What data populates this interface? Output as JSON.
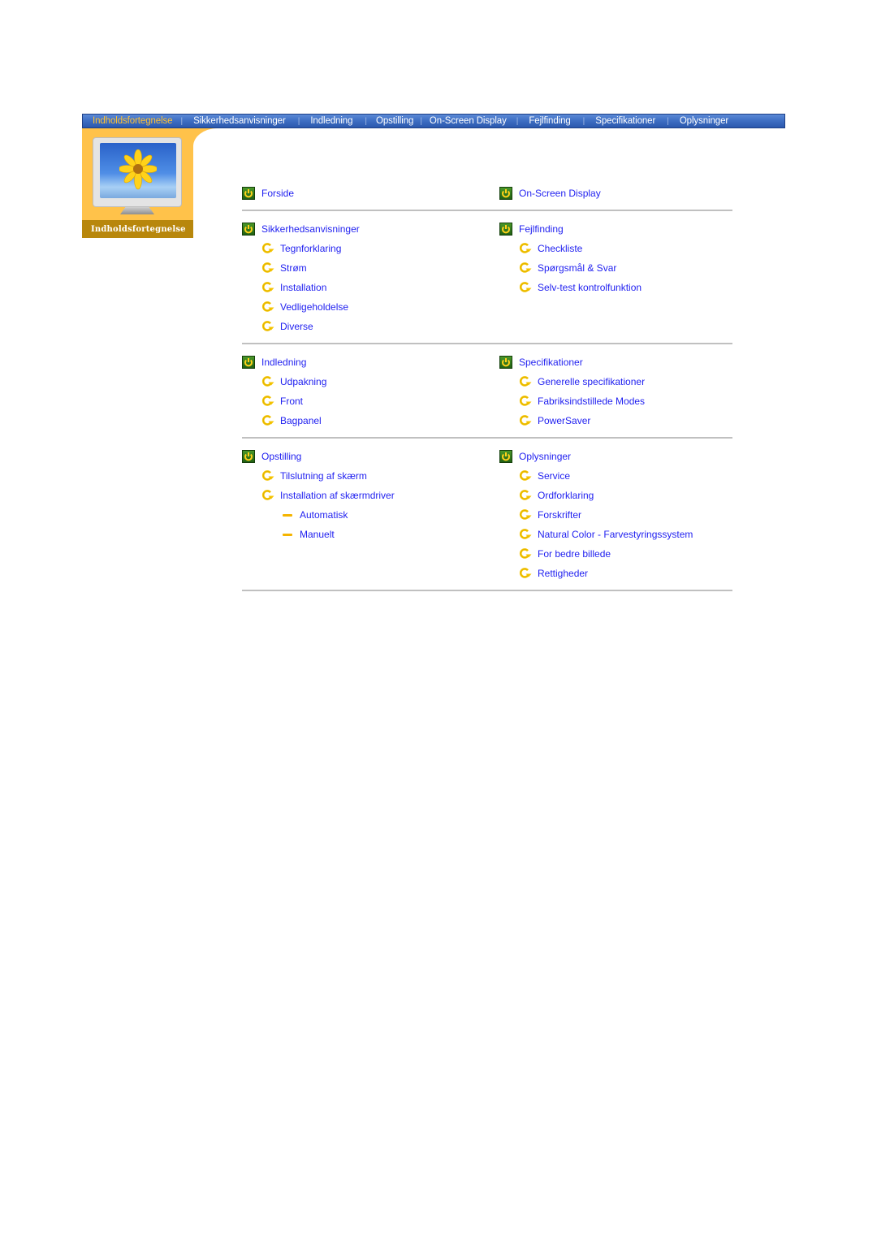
{
  "nav": {
    "items": [
      {
        "label": "Indholdsfortegnelse",
        "active": true
      },
      {
        "label": "Sikkerhedsanvisninger",
        "active": false
      },
      {
        "label": "Indledning",
        "active": false
      },
      {
        "label": "Opstilling",
        "active": false
      },
      {
        "label": "On-Screen Display",
        "active": false
      },
      {
        "label": "Fejlfinding",
        "active": false
      },
      {
        "label": "Specifikationer",
        "active": false
      },
      {
        "label": "Oplysninger",
        "active": false
      }
    ],
    "separator": "|",
    "colors": {
      "active": "#ffc233",
      "inactive": "#ffffff",
      "bar": "#3f6fc4"
    }
  },
  "side_panel": {
    "caption": "Indholdsfortegnelse",
    "image": "monitor-with-sunflower"
  },
  "toc": {
    "link_color": "#1f1ff0",
    "rows": [
      {
        "left": [
          {
            "level": 1,
            "label": "Forside",
            "icon": "power-box-icon"
          }
        ],
        "right": [
          {
            "level": 1,
            "label": "On-Screen Display",
            "icon": "power-box-icon"
          }
        ]
      },
      {
        "left": [
          {
            "level": 1,
            "label": "Sikkerhedsanvisninger",
            "icon": "power-box-icon"
          },
          {
            "level": 2,
            "label": "Tegnforklaring",
            "icon": "circular-arrow-icon"
          },
          {
            "level": 2,
            "label": "Strøm",
            "icon": "circular-arrow-icon"
          },
          {
            "level": 2,
            "label": "Installation",
            "icon": "circular-arrow-icon"
          },
          {
            "level": 2,
            "label": "Vedligeholdelse",
            "icon": "circular-arrow-icon"
          },
          {
            "level": 2,
            "label": "Diverse",
            "icon": "circular-arrow-icon"
          }
        ],
        "right": [
          {
            "level": 1,
            "label": "Fejlfinding",
            "icon": "power-box-icon"
          },
          {
            "level": 2,
            "label": "Checkliste",
            "icon": "circular-arrow-icon"
          },
          {
            "level": 2,
            "label": "Spørgsmål & Svar",
            "icon": "circular-arrow-icon"
          },
          {
            "level": 2,
            "label": "Selv-test kontrolfunktion",
            "icon": "circular-arrow-icon"
          }
        ]
      },
      {
        "left": [
          {
            "level": 1,
            "label": "Indledning",
            "icon": "power-box-icon"
          },
          {
            "level": 2,
            "label": "Udpakning",
            "icon": "circular-arrow-icon"
          },
          {
            "level": 2,
            "label": "Front",
            "icon": "circular-arrow-icon"
          },
          {
            "level": 2,
            "label": "Bagpanel",
            "icon": "circular-arrow-icon"
          }
        ],
        "right": [
          {
            "level": 1,
            "label": "Specifikationer",
            "icon": "power-box-icon"
          },
          {
            "level": 2,
            "label": "Generelle specifikationer",
            "icon": "circular-arrow-icon"
          },
          {
            "level": 2,
            "label": "Fabriksindstillede Modes",
            "icon": "circular-arrow-icon"
          },
          {
            "level": 2,
            "label": "PowerSaver",
            "icon": "circular-arrow-icon"
          }
        ]
      },
      {
        "left": [
          {
            "level": 1,
            "label": "Opstilling",
            "icon": "power-box-icon"
          },
          {
            "level": 2,
            "label": "Tilslutning af skærm",
            "icon": "circular-arrow-icon"
          },
          {
            "level": 2,
            "label": "Installation af skærmdriver",
            "icon": "circular-arrow-icon"
          },
          {
            "level": 3,
            "label": "Automatisk",
            "icon": "dash-icon"
          },
          {
            "level": 3,
            "label": "Manuelt",
            "icon": "dash-icon"
          }
        ],
        "right": [
          {
            "level": 1,
            "label": "Oplysninger",
            "icon": "power-box-icon"
          },
          {
            "level": 2,
            "label": "Service",
            "icon": "circular-arrow-icon"
          },
          {
            "level": 2,
            "label": "Ordforklaring",
            "icon": "circular-arrow-icon"
          },
          {
            "level": 2,
            "label": "Forskrifter",
            "icon": "circular-arrow-icon"
          },
          {
            "level": 2,
            "label": "Natural Color - Farvestyringssystem",
            "icon": "circular-arrow-icon"
          },
          {
            "level": 2,
            "label": "For bedre billede",
            "icon": "circular-arrow-icon"
          },
          {
            "level": 2,
            "label": "Rettigheder",
            "icon": "circular-arrow-icon"
          }
        ]
      }
    ]
  }
}
